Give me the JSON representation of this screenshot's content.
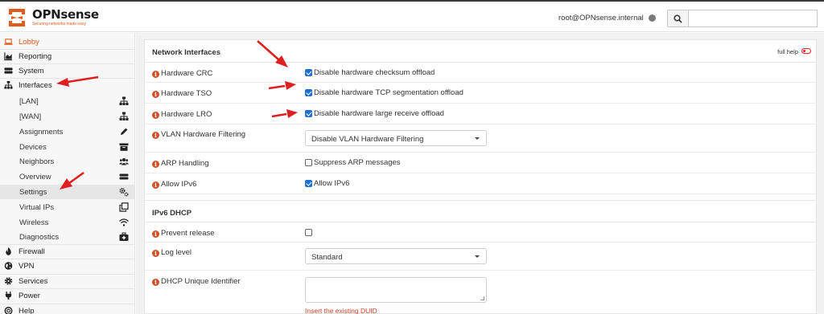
{
  "header": {
    "brand_name": "OPNsense",
    "brand_tagline": "Securing networks made easy",
    "user": "root@OPNsense.internal",
    "search": {
      "value": "",
      "placeholder": ""
    }
  },
  "sidebar": {
    "items": [
      {
        "label": "Lobby",
        "icon": "laptop-icon"
      },
      {
        "label": "Reporting",
        "icon": "area-chart-icon"
      },
      {
        "label": "System",
        "icon": "server-icon"
      },
      {
        "label": "Interfaces",
        "icon": "sitemap-icon"
      },
      {
        "label": "Firewall",
        "icon": "fire-icon"
      },
      {
        "label": "VPN",
        "icon": "globe-icon"
      },
      {
        "label": "Services",
        "icon": "cog-icon"
      },
      {
        "label": "Power",
        "icon": "plug-icon"
      },
      {
        "label": "Help",
        "icon": "support-icon"
      }
    ],
    "interfaces_sub": [
      {
        "label": "[LAN]",
        "icon": "sitemap-icon"
      },
      {
        "label": "[WAN]",
        "icon": "sitemap-icon"
      },
      {
        "label": "Assignments",
        "icon": "pencil-icon"
      },
      {
        "label": "Devices",
        "icon": "archive-icon"
      },
      {
        "label": "Neighbors",
        "icon": "users-icon"
      },
      {
        "label": "Overview",
        "icon": "tasks-icon"
      },
      {
        "label": "Settings",
        "icon": "cogs-icon"
      },
      {
        "label": "Virtual IPs",
        "icon": "clone-icon"
      },
      {
        "label": "Wireless",
        "icon": "wifi-icon"
      },
      {
        "label": "Diagnostics",
        "icon": "medkit-icon"
      }
    ]
  },
  "network_interfaces": {
    "title": "Network Interfaces",
    "full_help": "full help",
    "rows": [
      {
        "label": "Hardware CRC",
        "control": "checkbox",
        "checked": true,
        "option": "Disable hardware checksum offload"
      },
      {
        "label": "Hardware TSO",
        "control": "checkbox",
        "checked": true,
        "option": "Disable hardware TCP segmentation offload"
      },
      {
        "label": "Hardware LRO",
        "control": "checkbox",
        "checked": true,
        "option": "Disable hardware large receive offload"
      },
      {
        "label": "VLAN Hardware Filtering",
        "control": "select",
        "value": "Disable VLAN Hardware Filtering"
      },
      {
        "label": "ARP Handling",
        "control": "checkbox",
        "checked": false,
        "option": "Suppress ARP messages"
      },
      {
        "label": "Allow IPv6",
        "control": "checkbox",
        "checked": true,
        "option": "Allow IPv6"
      }
    ]
  },
  "ipv6_dhcp": {
    "title": "IPv6 DHCP",
    "rows": [
      {
        "label": "Prevent release",
        "control": "checkbox",
        "checked": false
      },
      {
        "label": "Log level",
        "control": "select",
        "value": "Standard"
      },
      {
        "label": "DHCP Unique Identifier",
        "control": "textarea",
        "value": "",
        "hint": "Insert the existing DUID"
      }
    ]
  },
  "colors": {
    "accent": "#e25c1b",
    "checkbox": "#1f6fd1",
    "annotation_arrow": "#e02020"
  }
}
